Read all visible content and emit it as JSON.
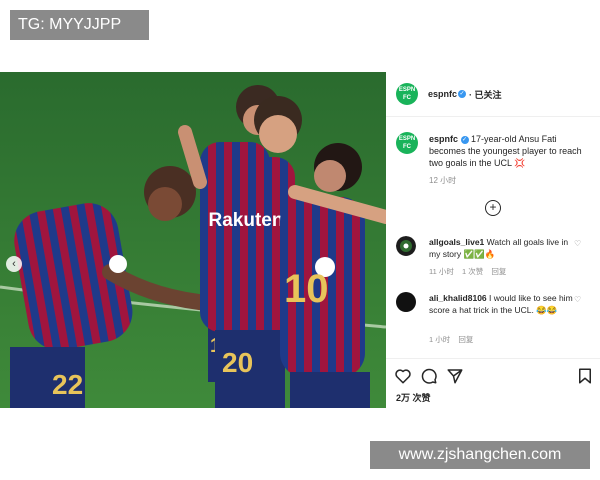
{
  "overlay": {
    "tg_label": "TG: MYYJJPP",
    "watermark": "www.zjshangchen.com"
  },
  "post": {
    "account": "espnfc",
    "logo_text": "ESPN FC",
    "follow_label": "· 已关注",
    "caption_user": "espnfc",
    "caption_text": "17-year-old Ansu Fati becomes the youngest player to reach two goals in the UCL 💢",
    "caption_time": "12 小时",
    "photo_text": {
      "sponsor": "Rakuten",
      "number_center": "20",
      "number_left": "22",
      "number_right": "10",
      "number_back": "17"
    },
    "comments": [
      {
        "user": "allgoals_live1",
        "text": "Watch all goals live in my story ✅✅🔥",
        "time": "11 小时",
        "likes": "1 次赞",
        "reply": "回复"
      },
      {
        "user": "ali_khalid8106",
        "text": "I would like to see him score a hat trick in the UCL. 😂😂",
        "time": "1 小时",
        "reply": "回复"
      }
    ],
    "likes_label": "2万 次赞",
    "colors": {
      "verified": "#3897f0",
      "espn_green": "#19b35a",
      "barca_blue": "#1f3a8a",
      "barca_red": "#a0153e"
    }
  }
}
